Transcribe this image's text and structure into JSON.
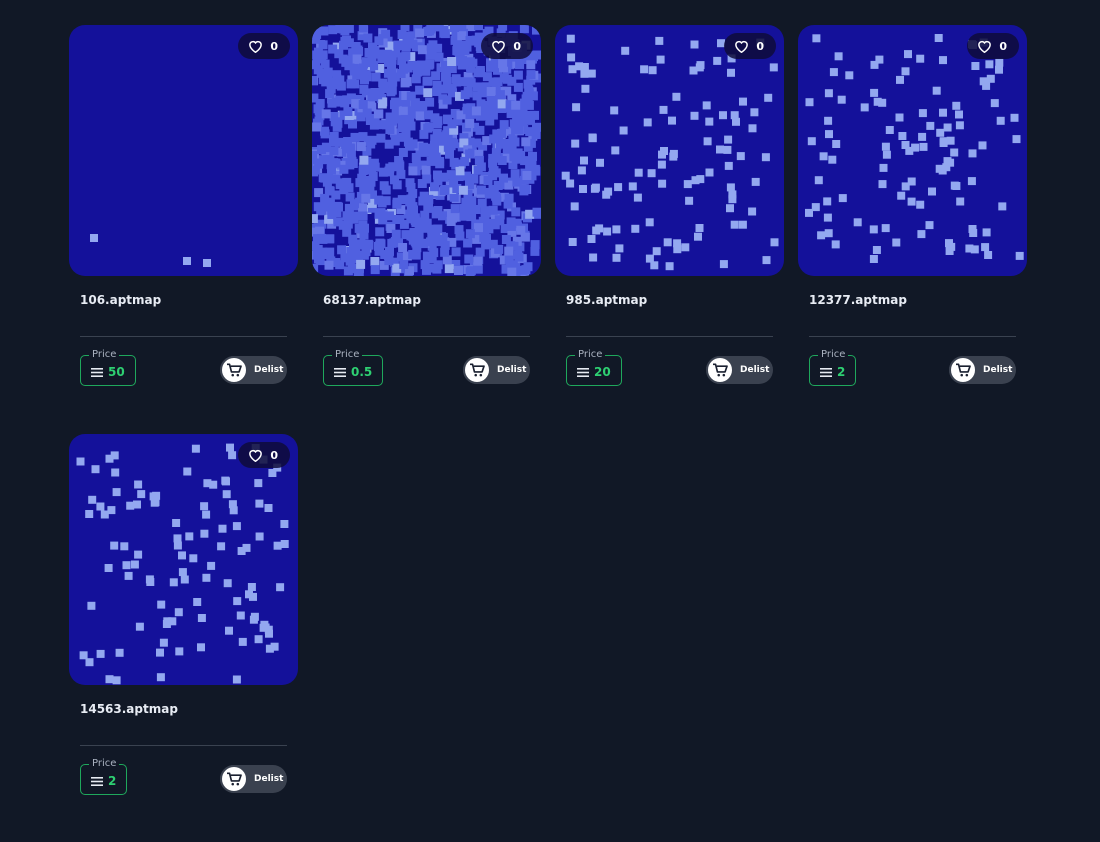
{
  "colors": {
    "background": "#111826",
    "thumbnail_bg": "#14119a",
    "dot_light": "#93a8f0",
    "dot_blue": "#5060e0",
    "price_accent": "#2ed072"
  },
  "cards": [
    {
      "name": "106.aptmap",
      "likes": "0",
      "price_label": "Price",
      "price": "50",
      "delist_label": "Delist",
      "pattern": "sparse-few"
    },
    {
      "name": "68137.aptmap",
      "likes": "0",
      "price_label": "Price",
      "price": "0.5",
      "delist_label": "Delist",
      "pattern": "dense"
    },
    {
      "name": "985.aptmap",
      "likes": "0",
      "price_label": "Price",
      "price": "20",
      "delist_label": "Delist",
      "pattern": "scattered"
    },
    {
      "name": "12377.aptmap",
      "likes": "0",
      "price_label": "Price",
      "price": "2",
      "delist_label": "Delist",
      "pattern": "scattered"
    },
    {
      "name": "14563.aptmap",
      "likes": "0",
      "price_label": "Price",
      "price": "2",
      "delist_label": "Delist",
      "pattern": "scattered"
    }
  ]
}
